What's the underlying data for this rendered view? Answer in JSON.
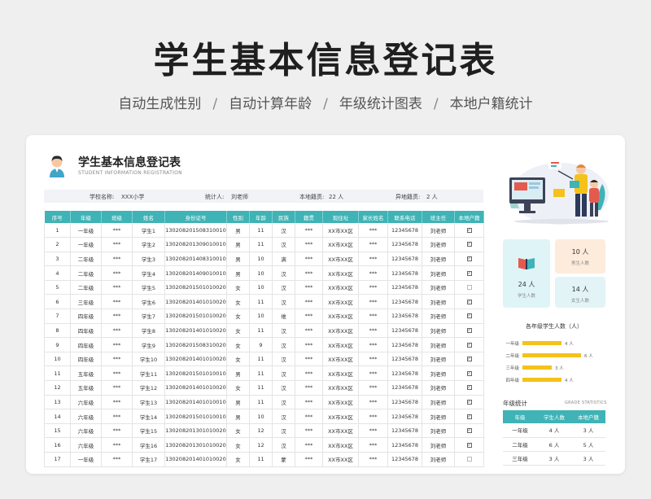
{
  "banner": {
    "title": "学生基本信息登记表",
    "features": [
      "自动生成性别",
      "自动计算年龄",
      "年级统计图表",
      "本地户籍统计"
    ],
    "separator": "/"
  },
  "sheet": {
    "title": "学生基本信息登记表",
    "subtitle": "STUDENT INFORMATION REGISTRATION"
  },
  "info": {
    "school_label": "学校名称:",
    "school_value": "XXX小学",
    "stats_person_label": "统计人:",
    "stats_person_value": "刘老师",
    "local_label": "本地籍贯:",
    "local_value": "22 人",
    "nonlocal_label": "异地籍贯:",
    "nonlocal_value": "2 人"
  },
  "table": {
    "headers": [
      "序号",
      "年级",
      "班级",
      "姓名",
      "身份证号",
      "性别",
      "年龄",
      "民族",
      "籍贯",
      "现住址",
      "家长姓名",
      "联系电话",
      "班主任",
      "本地户籍"
    ],
    "rows": [
      {
        "no": "1",
        "grade": "一年级",
        "cls": "***",
        "name": "学生1",
        "id": "130208201508310010",
        "gender": "男",
        "age": "11",
        "eth": "汉",
        "origin": "***",
        "addr": "XX市XX区",
        "parent": "***",
        "phone": "12345678",
        "teacher": "刘老师",
        "local": true
      },
      {
        "no": "2",
        "grade": "一年级",
        "cls": "***",
        "name": "学生2",
        "id": "130208201309010010",
        "gender": "男",
        "age": "11",
        "eth": "汉",
        "origin": "***",
        "addr": "XX市XX区",
        "parent": "***",
        "phone": "12345678",
        "teacher": "刘老师",
        "local": true
      },
      {
        "no": "3",
        "grade": "二年级",
        "cls": "***",
        "name": "学生3",
        "id": "130208201408310010",
        "gender": "男",
        "age": "10",
        "eth": "满",
        "origin": "***",
        "addr": "XX市XX区",
        "parent": "***",
        "phone": "12345678",
        "teacher": "刘老师",
        "local": true
      },
      {
        "no": "4",
        "grade": "二年级",
        "cls": "***",
        "name": "学生4",
        "id": "130208201409010010",
        "gender": "男",
        "age": "10",
        "eth": "汉",
        "origin": "***",
        "addr": "XX市XX区",
        "parent": "***",
        "phone": "12345678",
        "teacher": "刘老师",
        "local": true
      },
      {
        "no": "5",
        "grade": "二年级",
        "cls": "***",
        "name": "学生5",
        "id": "130208201501010020",
        "gender": "女",
        "age": "10",
        "eth": "汉",
        "origin": "***",
        "addr": "XX市XX区",
        "parent": "***",
        "phone": "12345678",
        "teacher": "刘老师",
        "local": false
      },
      {
        "no": "6",
        "grade": "三年级",
        "cls": "***",
        "name": "学生6",
        "id": "130208201401010020",
        "gender": "女",
        "age": "11",
        "eth": "汉",
        "origin": "***",
        "addr": "XX市XX区",
        "parent": "***",
        "phone": "12345678",
        "teacher": "刘老师",
        "local": true
      },
      {
        "no": "7",
        "grade": "四年级",
        "cls": "***",
        "name": "学生7",
        "id": "130208201501010020",
        "gender": "女",
        "age": "10",
        "eth": "维",
        "origin": "***",
        "addr": "XX市XX区",
        "parent": "***",
        "phone": "12345678",
        "teacher": "刘老师",
        "local": true
      },
      {
        "no": "8",
        "grade": "四年级",
        "cls": "***",
        "name": "学生8",
        "id": "130208201401010020",
        "gender": "女",
        "age": "11",
        "eth": "汉",
        "origin": "***",
        "addr": "XX市XX区",
        "parent": "***",
        "phone": "12345678",
        "teacher": "刘老师",
        "local": true
      },
      {
        "no": "9",
        "grade": "四年级",
        "cls": "***",
        "name": "学生9",
        "id": "130208201508310020",
        "gender": "女",
        "age": "9",
        "eth": "汉",
        "origin": "***",
        "addr": "XX市XX区",
        "parent": "***",
        "phone": "12345678",
        "teacher": "刘老师",
        "local": true
      },
      {
        "no": "10",
        "grade": "四年级",
        "cls": "***",
        "name": "学生10",
        "id": "130208201401010020",
        "gender": "女",
        "age": "11",
        "eth": "汉",
        "origin": "***",
        "addr": "XX市XX区",
        "parent": "***",
        "phone": "12345678",
        "teacher": "刘老师",
        "local": true
      },
      {
        "no": "11",
        "grade": "五年级",
        "cls": "***",
        "name": "学生11",
        "id": "130208201501010010",
        "gender": "男",
        "age": "11",
        "eth": "汉",
        "origin": "***",
        "addr": "XX市XX区",
        "parent": "***",
        "phone": "12345678",
        "teacher": "刘老师",
        "local": true
      },
      {
        "no": "12",
        "grade": "五年级",
        "cls": "***",
        "name": "学生12",
        "id": "130208201401010020",
        "gender": "女",
        "age": "11",
        "eth": "汉",
        "origin": "***",
        "addr": "XX市XX区",
        "parent": "***",
        "phone": "12345678",
        "teacher": "刘老师",
        "local": true
      },
      {
        "no": "13",
        "grade": "六年级",
        "cls": "***",
        "name": "学生13",
        "id": "130208201401010010",
        "gender": "男",
        "age": "11",
        "eth": "汉",
        "origin": "***",
        "addr": "XX市XX区",
        "parent": "***",
        "phone": "12345678",
        "teacher": "刘老师",
        "local": true
      },
      {
        "no": "14",
        "grade": "六年级",
        "cls": "***",
        "name": "学生14",
        "id": "130208201501010010",
        "gender": "男",
        "age": "10",
        "eth": "汉",
        "origin": "***",
        "addr": "XX市XX区",
        "parent": "***",
        "phone": "12345678",
        "teacher": "刘老师",
        "local": true
      },
      {
        "no": "15",
        "grade": "六年级",
        "cls": "***",
        "name": "学生15",
        "id": "130208201301010020",
        "gender": "女",
        "age": "12",
        "eth": "汉",
        "origin": "***",
        "addr": "XX市XX区",
        "parent": "***",
        "phone": "12345678",
        "teacher": "刘老师",
        "local": true
      },
      {
        "no": "16",
        "grade": "六年级",
        "cls": "***",
        "name": "学生16",
        "id": "130208201301010020",
        "gender": "女",
        "age": "12",
        "eth": "汉",
        "origin": "***",
        "addr": "XX市XX区",
        "parent": "***",
        "phone": "12345678",
        "teacher": "刘老师",
        "local": true
      },
      {
        "no": "17",
        "grade": "一年级",
        "cls": "***",
        "name": "学生17",
        "id": "130208201401010020",
        "gender": "女",
        "age": "11",
        "eth": "蒙",
        "origin": "***",
        "addr": "XX市XX区",
        "parent": "***",
        "phone": "12345678",
        "teacher": "刘老师",
        "local": false
      }
    ],
    "check_mark": "✓"
  },
  "stats": {
    "total_value": "24 人",
    "total_label": "学生人数",
    "local_value": "10 人",
    "local_label": "男生人数",
    "female_value": "14 人",
    "female_label": "女生人数"
  },
  "chart_data": {
    "type": "bar",
    "title": "各年级学生人数（人）",
    "categories": [
      "一年级",
      "二年级",
      "三年级",
      "四年级"
    ],
    "values": [
      4,
      6,
      3,
      4
    ],
    "value_labels": [
      "4 人",
      "6 人",
      "3 人",
      "4 人"
    ],
    "orientation": "horizontal",
    "xlim": [
      0,
      6
    ]
  },
  "grade_stats": {
    "title": "年级统计",
    "title_en": "GRADE STATISTICS",
    "headers": [
      "年级",
      "学生人数",
      "本地户籍"
    ],
    "rows": [
      {
        "grade": "一年级",
        "count": "4 人",
        "local": "3 人"
      },
      {
        "grade": "二年级",
        "count": "6 人",
        "local": "5 人"
      },
      {
        "grade": "三年级",
        "count": "3 人",
        "local": "3 人"
      }
    ]
  },
  "colors": {
    "accent_teal": "#3fb3b6",
    "bar_yellow": "#f5c21b",
    "card_teal": "#dff4f6",
    "card_peach": "#fdebdc"
  }
}
